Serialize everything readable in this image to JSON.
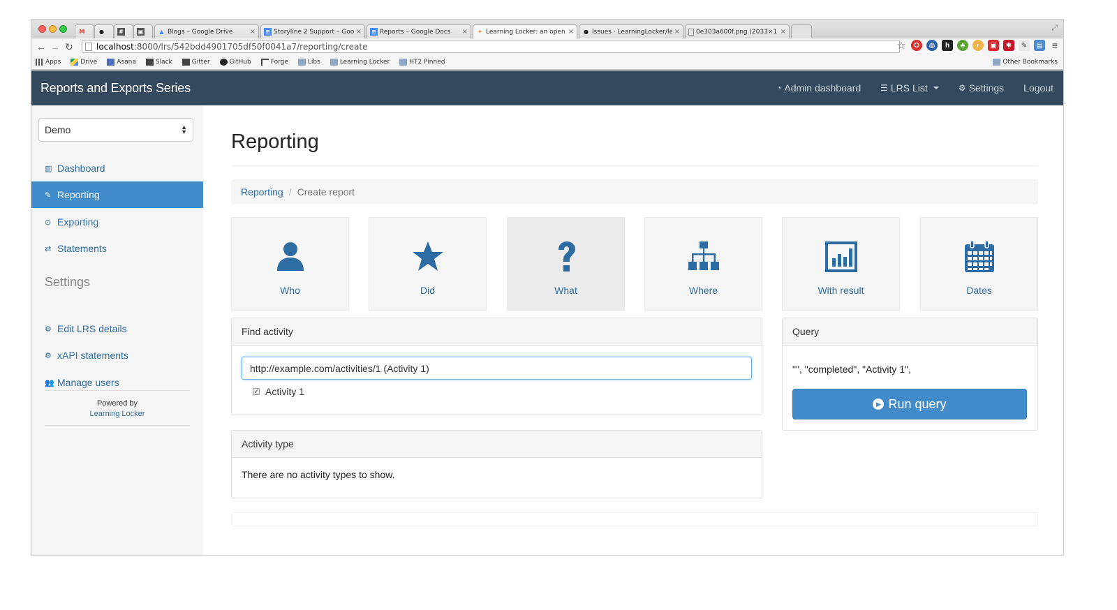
{
  "browser": {
    "tabs": [
      {
        "icon": "gmail-icon",
        "label": "",
        "color": "#d44638"
      },
      {
        "icon": "github-icon",
        "label": "",
        "color": "#222222"
      },
      {
        "icon": "hash-icon",
        "label": "",
        "color": "#555555"
      },
      {
        "icon": "box-icon",
        "label": "",
        "color": "#555555"
      },
      {
        "icon": "drive-icon",
        "label": "Blogs – Google Drive",
        "color": "#4a8af4"
      },
      {
        "icon": "doc-icon",
        "label": "Storyline 2 Support – Goo",
        "color": "#4a8af4"
      },
      {
        "icon": "doc-icon",
        "label": "Reports – Google Docs",
        "color": "#4a8af4"
      },
      {
        "icon": "locker-icon",
        "label": "Learning Locker: an open",
        "color": "#e87c2d"
      },
      {
        "icon": "github-icon",
        "label": "Issues · LearningLocker/le",
        "color": "#222222"
      },
      {
        "icon": "file-icon",
        "label": "0e303a600f.png (2033×1",
        "color": "#888888"
      }
    ],
    "url_host": "localhost",
    "url_path": ":8000/lrs/542bdd4901705df50f0041a7/reporting/create",
    "bookmarks": [
      "Apps",
      "Drive",
      "Asana",
      "Slack",
      "Gitter",
      "GitHub",
      "Forge",
      "Libs",
      "Learning Locker",
      "HT2 Pinned"
    ],
    "other_bookmarks": "Other Bookmarks"
  },
  "navbar": {
    "brand": "Reports and Exports Series",
    "links": {
      "admin": "Admin dashboard",
      "lrs_list": "LRS List",
      "settings": "Settings",
      "logout": "Logout"
    }
  },
  "sidebar": {
    "select_value": "Demo",
    "nav": {
      "dashboard": "Dashboard",
      "reporting": "Reporting",
      "exporting": "Exporting",
      "statements": "Statements"
    },
    "settings_heading": "Settings",
    "settings": {
      "edit_lrs": "Edit LRS details",
      "xapi": "xAPI statements",
      "users": "Manage users"
    },
    "powered_by": "Powered by",
    "powered_link": "Learning Locker"
  },
  "main": {
    "title": "Reporting",
    "breadcrumb": {
      "link": "Reporting",
      "separator": "/",
      "current": "Create report"
    },
    "tiles": {
      "who": "Who",
      "did": "Did",
      "what": "What",
      "where": "Where",
      "with_result": "With result",
      "dates": "Dates"
    },
    "find_activity": {
      "heading": "Find activity",
      "input_value": "http://example.com/activities/1 (Activity 1)",
      "checked_item": "Activity 1"
    },
    "activity_type": {
      "heading": "Activity type",
      "empty_text": "There are no activity types to show."
    },
    "query": {
      "heading": "Query",
      "text": "\"\", \"completed\", \"Activity 1\",",
      "run_label": "Run query"
    }
  },
  "colors": {
    "navbar": "#34495e",
    "primary": "#428bca",
    "link": "#2d6ca2"
  }
}
